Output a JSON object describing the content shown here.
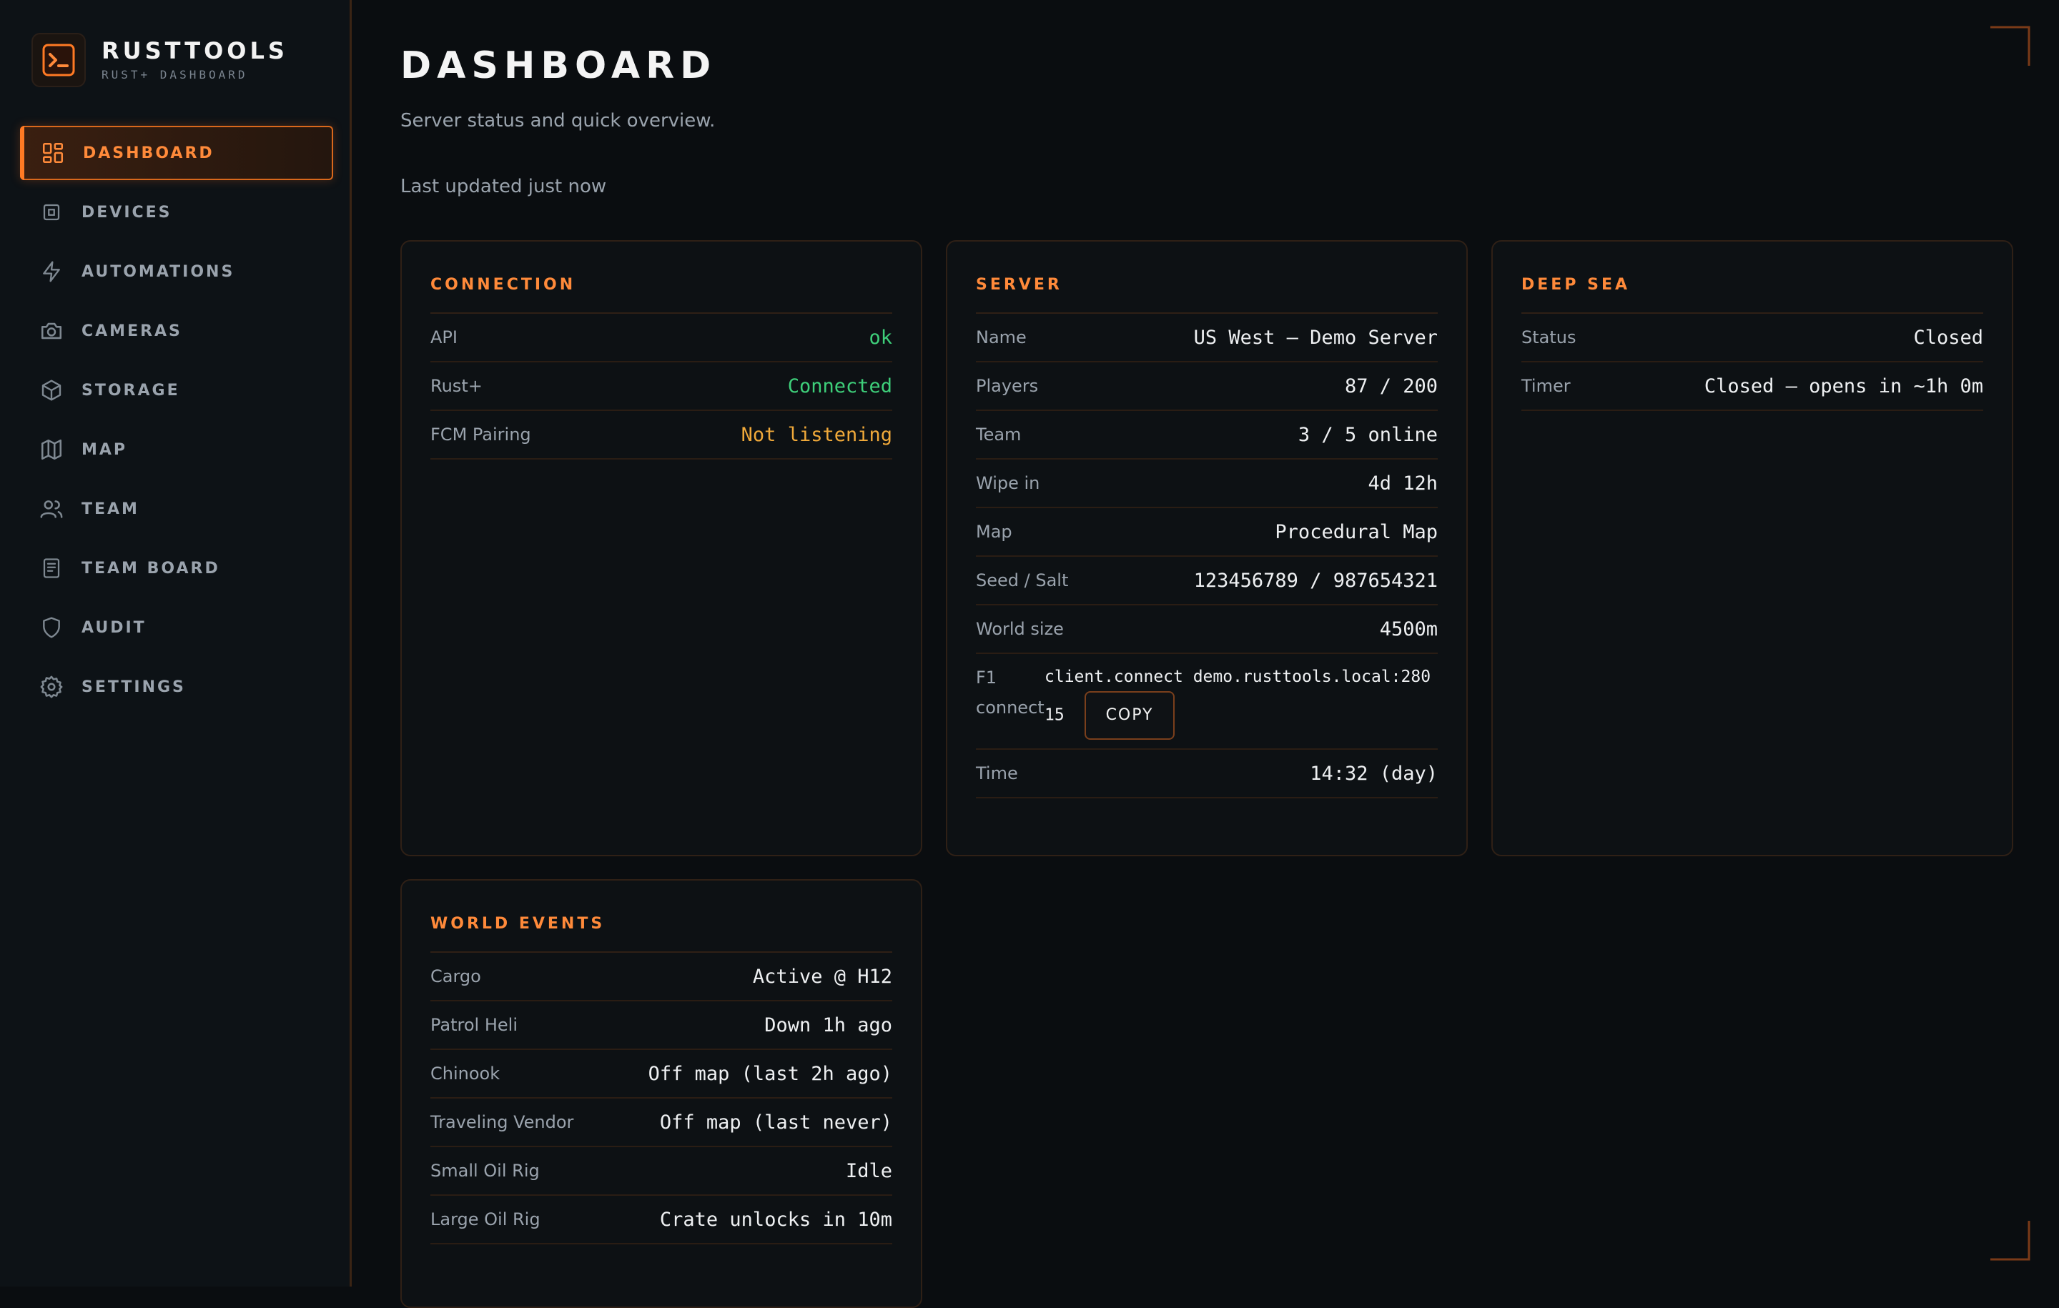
{
  "brand": {
    "title": "RUSTTOOLS",
    "subtitle": "RUST+ DASHBOARD"
  },
  "nav": [
    {
      "label": "DASHBOARD",
      "icon": "grid-icon",
      "active": true
    },
    {
      "label": "DEVICES",
      "icon": "chip-icon"
    },
    {
      "label": "AUTOMATIONS",
      "icon": "bolt-icon"
    },
    {
      "label": "CAMERAS",
      "icon": "camera-icon"
    },
    {
      "label": "STORAGE",
      "icon": "box-icon"
    },
    {
      "label": "MAP",
      "icon": "map-icon"
    },
    {
      "label": "TEAM",
      "icon": "users-icon"
    },
    {
      "label": "TEAM BOARD",
      "icon": "board-icon"
    },
    {
      "label": "AUDIT",
      "icon": "shield-icon"
    },
    {
      "label": "SETTINGS",
      "icon": "gear-icon"
    }
  ],
  "header": {
    "title": "DASHBOARD",
    "subtitle": "Server status and quick overview.",
    "updated": "Last updated just now"
  },
  "connection": {
    "title": "CONNECTION",
    "rows": [
      {
        "k": "API",
        "v": "ok"
      },
      {
        "k": "Rust+",
        "v": "Connected"
      },
      {
        "k": "FCM Pairing",
        "v": "Not listening"
      }
    ]
  },
  "server": {
    "title": "SERVER",
    "rows": [
      {
        "k": "Name",
        "v": "US West — Demo Server"
      },
      {
        "k": "Players",
        "v": "87 / 200"
      },
      {
        "k": "Team",
        "v": "3 / 5 online"
      },
      {
        "k": "Wipe in",
        "v": "4d 12h"
      },
      {
        "k": "Map",
        "v": "Procedural Map"
      },
      {
        "k": "Seed / Salt",
        "v": "123456789 / 987654321"
      },
      {
        "k": "World size",
        "v": "4500m"
      }
    ],
    "f1": {
      "k_line1": "F1",
      "k_line2": "connect",
      "cmd_line1": "client.connect demo.rusttools.local:280",
      "cmd_line2": "15",
      "copy": "COPY"
    },
    "time": {
      "k": "Time",
      "v": "14:32 (day)"
    }
  },
  "deepsea": {
    "title": "DEEP SEA",
    "rows": [
      {
        "k": "Status",
        "v": "Closed"
      },
      {
        "k": "Timer",
        "v": "Closed — opens in ~1h 0m"
      }
    ]
  },
  "events": {
    "title": "WORLD EVENTS",
    "rows": [
      {
        "k": "Cargo",
        "v": "Active @ H12"
      },
      {
        "k": "Patrol Heli",
        "v": "Down 1h ago"
      },
      {
        "k": "Chinook",
        "v": "Off map (last 2h ago)"
      },
      {
        "k": "Traveling Vendor",
        "v": "Off map (last never)"
      },
      {
        "k": "Small Oil Rig",
        "v": "Idle"
      },
      {
        "k": "Large Oil Rig",
        "v": "Crate unlocks in 10m"
      }
    ]
  },
  "colors": {
    "accent": "#ff8a3a",
    "ok": "#3ecf7a",
    "warn": "#f0a93a",
    "bg": "#0a0d10"
  }
}
